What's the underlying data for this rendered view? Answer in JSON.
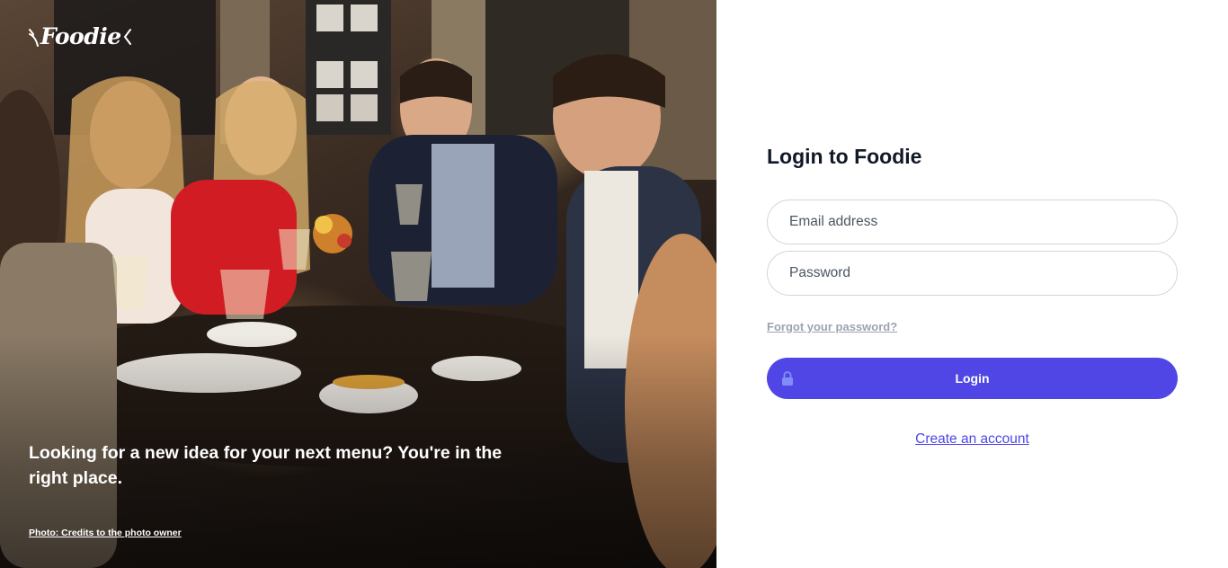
{
  "brand": {
    "logo_text": "Foodie"
  },
  "hero": {
    "tagline": "Looking for a new idea for your next menu? You're in the right place.",
    "photo_credit": "Photo: Credits to the photo owner"
  },
  "login": {
    "title": "Login to Foodie",
    "email_placeholder": "Email address",
    "password_placeholder": "Password",
    "forgot_password": "Forgot your password?",
    "login_button": "Login",
    "create_account": "Create an account"
  },
  "colors": {
    "accent": "#4f46e5",
    "heading": "#111827",
    "muted_link": "#9ca3af"
  },
  "icons": {
    "login_button_icon": "lock-icon",
    "logo_left": "fork-icon",
    "logo_right": "knife-icon"
  }
}
